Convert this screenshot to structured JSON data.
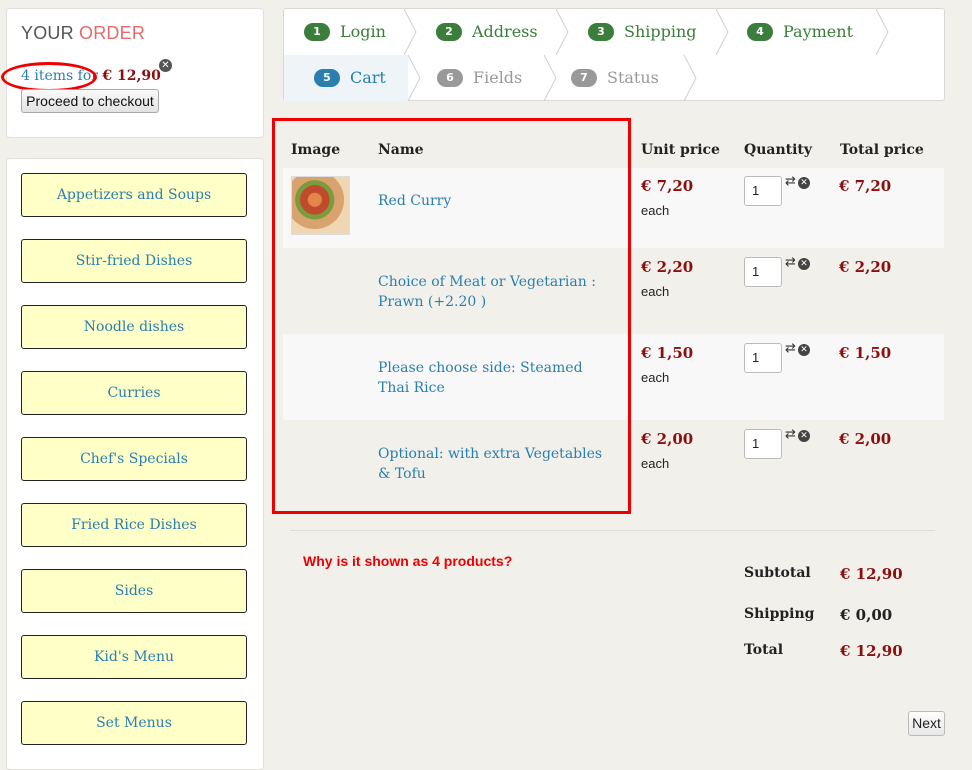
{
  "order": {
    "title_prefix": "YOUR",
    "title_accent": "ORDER",
    "items_text": "4 items for",
    "total": "€ 12,90",
    "remove_icon": "close-circle-icon",
    "checkout_label": "Proceed to checkout",
    "accent_color": "#e56b6b"
  },
  "categories": [
    "Appetizers and Soups",
    "Stir-fried Dishes",
    "Noodle dishes",
    "Curries",
    "Chef's Specials",
    "Fried Rice Dishes",
    "Sides",
    "Kid's Menu",
    "Set Menus"
  ],
  "steps": [
    {
      "num": "1",
      "label": "Login",
      "state": "done"
    },
    {
      "num": "2",
      "label": "Address",
      "state": "done"
    },
    {
      "num": "3",
      "label": "Shipping",
      "state": "done"
    },
    {
      "num": "4",
      "label": "Payment",
      "state": "done"
    },
    {
      "num": "5",
      "label": "Cart",
      "state": "current"
    },
    {
      "num": "6",
      "label": "Fields",
      "state": "todo"
    },
    {
      "num": "7",
      "label": "Status",
      "state": "todo"
    }
  ],
  "cart": {
    "headers": {
      "image": "Image",
      "name": "Name",
      "unit_price": "Unit price",
      "quantity": "Quantity",
      "total_price": "Total price"
    },
    "each_label": "each",
    "rows": [
      {
        "name": "Red Curry",
        "unit_price": "€ 7,20",
        "qty": "1",
        "total": "€ 7,20"
      },
      {
        "name": "Choice of Meat or Vegetarian : Prawn (+2.20  )",
        "unit_price": "€ 2,20",
        "qty": "1",
        "total": "€ 2,20"
      },
      {
        "name": "Please choose side: Steamed Thai Rice",
        "unit_price": "€ 1,50",
        "qty": "1",
        "total": "€ 1,50"
      },
      {
        "name": "Optional: with extra Vegetables & Tofu",
        "unit_price": "€ 2,00",
        "qty": "1",
        "total": "€ 2,00"
      }
    ]
  },
  "question": "Why is it shown as 4 products?",
  "summary": {
    "subtotal_label": "Subtotal",
    "subtotal": "€ 12,90",
    "shipping_label": "Shipping",
    "shipping": "€ 0,00",
    "total_label": "Total",
    "total": "€ 12,90"
  },
  "next_label": "Next",
  "colors": {
    "price": "#8b0f0f",
    "link": "#2a7fae",
    "done_step": "#3b7d3b",
    "annotation": "#ee0000",
    "category_bg": "#ffffc8"
  }
}
